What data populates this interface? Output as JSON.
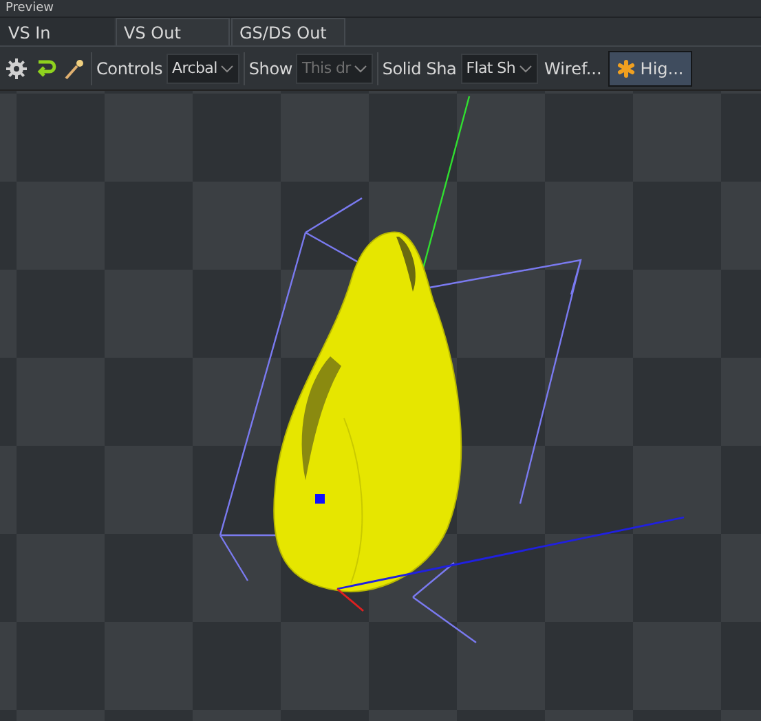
{
  "panel": {
    "title": "Preview"
  },
  "tabs": [
    {
      "label": "VS In",
      "selected": true
    },
    {
      "label": "VS Out",
      "selected": false
    },
    {
      "label": "GS/DS Out",
      "selected": false
    }
  ],
  "toolbar": {
    "controls_label": "Controls",
    "controls_value": "Arcbal",
    "show_label": "Show",
    "show_value": "This dr",
    "solid_label": "Solid Sha",
    "solid_value": "Flat Sh",
    "wireframe_label": "Wiref...",
    "highlight": {
      "label": "Hig...",
      "selected": true
    }
  }
}
